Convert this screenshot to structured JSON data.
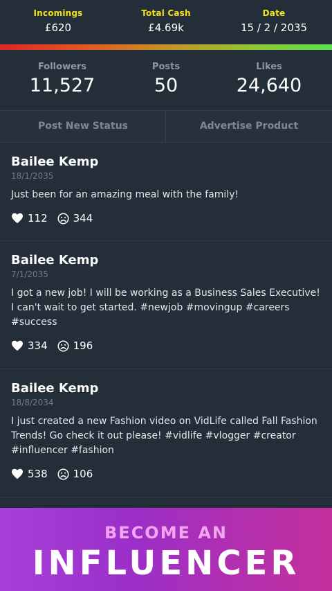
{
  "header": {
    "incomings_label": "Incomings",
    "incomings_value": "£620",
    "cash_label": "Total Cash",
    "cash_value": "£4.69k",
    "date_label": "Date",
    "date_value": "15 / 2 / 2035"
  },
  "stats": {
    "followers_label": "Followers",
    "followers_value": "11,527",
    "posts_label": "Posts",
    "posts_value": "50",
    "likes_label": "Likes",
    "likes_value": "24,640"
  },
  "actions": {
    "post_status": "Post New Status",
    "advertise": "Advertise Product"
  },
  "posts": [
    {
      "author": "Bailee Kemp",
      "date": "18/1/2035",
      "text": "Just been for an amazing meal with the family!",
      "likes": "112",
      "dislikes": "344"
    },
    {
      "author": "Bailee Kemp",
      "date": "7/1/2035",
      "text": "I got a new job! I will be working as a Business Sales Executive! I can't wait to get started. #newjob #movingup #careers #success",
      "likes": "334",
      "dislikes": "196"
    },
    {
      "author": "Bailee Kemp",
      "date": "18/8/2034",
      "text": "I just created a new Fashion video on VidLife called Fall Fashion Trends! Go check it out please! #vidlife #vlogger #creator #influencer #fashion",
      "likes": "538",
      "dislikes": "106"
    }
  ],
  "banner": {
    "line1": "BECOME AN",
    "line2": "INFLUENCER"
  },
  "icons": {
    "like": "heart-icon",
    "dislike": "sad-face-icon"
  },
  "colors": {
    "accent": "#f3e21c",
    "banner_start": "#a63fd9",
    "banner_end": "#c3309d"
  }
}
